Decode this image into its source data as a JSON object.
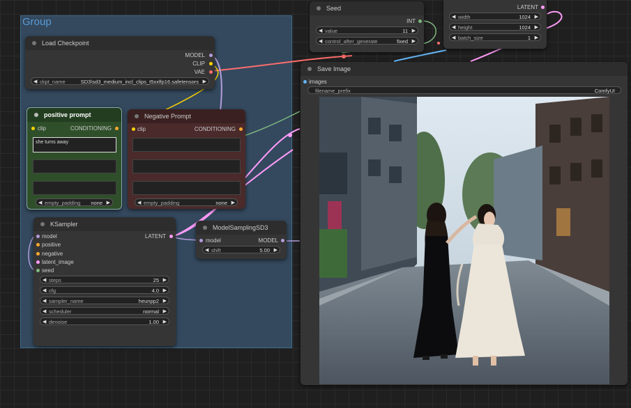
{
  "group": {
    "title": "Group"
  },
  "load_checkpoint": {
    "title": "Load Checkpoint",
    "outputs": [
      "MODEL",
      "CLIP",
      "VAE"
    ],
    "ckpt_name_label": "ckpt_name",
    "ckpt_name_value": "SD3\\sd3_medium_incl_clips_t5xxlfp16.safetensors"
  },
  "positive_prompt": {
    "title": "positive prompt",
    "input": "clip",
    "output": "CONDITIONING",
    "text1": "she turns away",
    "text2": "",
    "text3": "",
    "padding_label": "empty_padding",
    "padding_value": "none"
  },
  "negative_prompt": {
    "title": "Negative Prompt",
    "input": "clip",
    "output": "CONDITIONING",
    "padding_label": "empty_padding",
    "padding_value": "none"
  },
  "ksampler": {
    "title": "KSampler",
    "inputs": [
      "model",
      "positive",
      "negative",
      "latent_image",
      "seed"
    ],
    "output": "LATENT",
    "widgets": [
      {
        "label": "steps",
        "value": "25"
      },
      {
        "label": "cfg",
        "value": "4.0"
      },
      {
        "label": "sampler_name",
        "value": "heunpp2"
      },
      {
        "label": "scheduler",
        "value": "normal"
      },
      {
        "label": "denoise",
        "value": "1.00"
      }
    ]
  },
  "model_sampling": {
    "title": "ModelSamplingSD3",
    "input": "model",
    "output": "MODEL",
    "shift_label": "shift",
    "shift_value": "5.00"
  },
  "seed_node": {
    "title": "Seed",
    "output": "INT",
    "value_label": "value",
    "value_value": "11",
    "cag_label": "control_after_generate",
    "cag_value": "fixed"
  },
  "latent_node": {
    "output": "LATENT",
    "widgets": [
      {
        "label": "width",
        "value": "1024"
      },
      {
        "label": "height",
        "value": "1024"
      },
      {
        "label": "batch_size",
        "value": "1"
      }
    ]
  },
  "save_image": {
    "title": "Save Image",
    "input": "images",
    "prefix_label": "filename_prefix",
    "prefix_value": "ComfyUI"
  },
  "colors": {
    "clip_yellow": "#ffd500",
    "model_lavender": "#b39ddb",
    "vae_red": "#ff6e6e",
    "cond_orange": "#ffa931",
    "latent_pink": "#ff9cf9",
    "int_green": "#7fb87f",
    "image_blue": "#64b5f6",
    "positive_green": "#2f4f2a",
    "negative_red": "#4a2a2a"
  }
}
